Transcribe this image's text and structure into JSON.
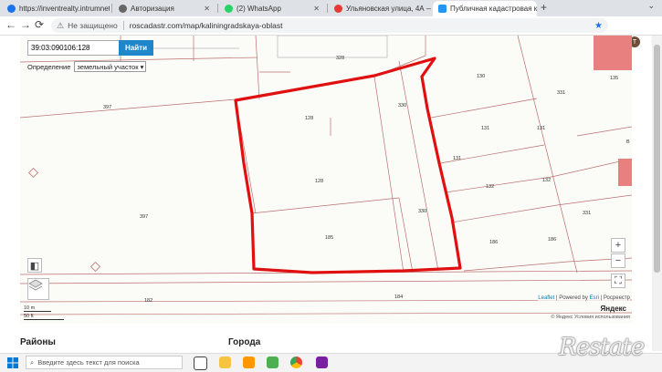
{
  "tabs": [
    {
      "title": "https://inventrealty.intrumnet",
      "color": "#1a73e8"
    },
    {
      "title": "Авторизация",
      "color": "#666666"
    },
    {
      "title": "(2) WhatsApp",
      "color": "#25d366"
    },
    {
      "title": "Ульяновская улица, 4А — Я",
      "color": "#e53935"
    },
    {
      "title": "Публичная кадастровая карт",
      "color": "#2196f3"
    }
  ],
  "toolbar": {
    "security": "Не защищено",
    "url": "roscadastr.com/map/kaliningradskaya-oblast",
    "avatar_letter": "T"
  },
  "map": {
    "search_value": "39:03:090106:128",
    "search_button": "Найти",
    "detect_label": "Определение",
    "detect_selected": "земельный участок",
    "zoom_in": "+",
    "zoom_out": "−",
    "scale_m": "10 m",
    "scale_ft": "50 ft",
    "attribution_leaflet": "Leaflet",
    "attribution_powered": "| Powered by",
    "attribution_esri": "Esri",
    "attribution_rosreestr": "| Росреестр",
    "yandex_logo": "Яндекс",
    "copyright": "© Яндекс  Условия использования",
    "parcels": {
      "p328": "328",
      "p130a": "130",
      "p135": "135",
      "p331a": "331",
      "p397a": "397",
      "p128a": "128",
      "p330a": "330",
      "p131a": "131",
      "p131b": "131",
      "p131c": "131",
      "p128b": "128",
      "p132a": "132",
      "p132b": "132",
      "p397b": "397",
      "p330b": "330",
      "p331b": "331",
      "p185": "185",
      "p186a": "186",
      "p186b": "186",
      "p182": "182",
      "p184": "184",
      "p135b": "135",
      "pB": "В"
    }
  },
  "below": {
    "districts": "Районы",
    "cities": "Города"
  },
  "taskbar": {
    "search_placeholder": "Введите здесь текст для поиска"
  },
  "watermark": "Restate"
}
